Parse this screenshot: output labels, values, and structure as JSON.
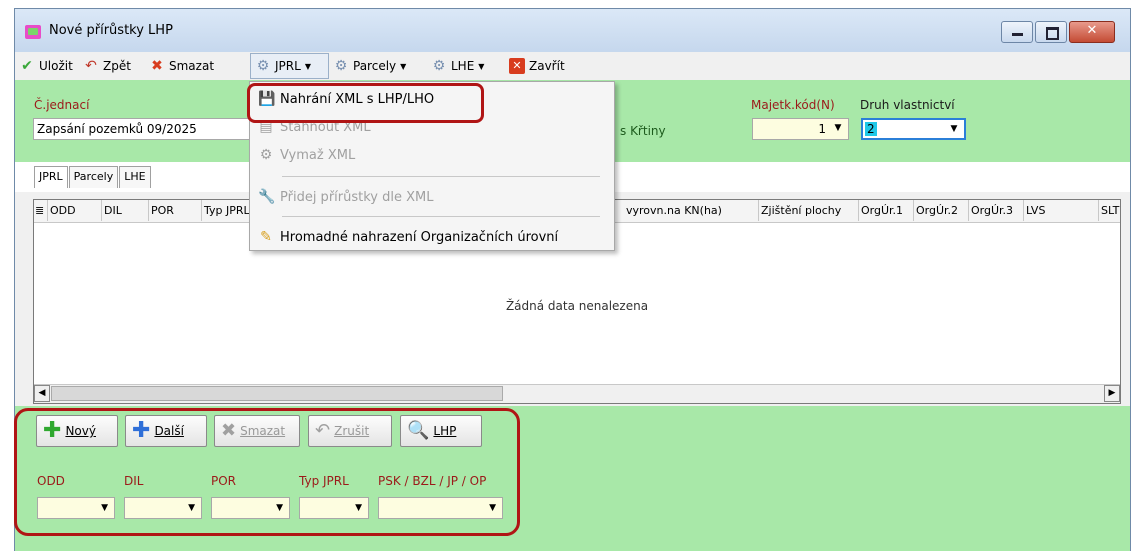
{
  "window": {
    "title": "Nové přírůstky LHP"
  },
  "toolbar": {
    "save": "Uložit",
    "back": "Zpět",
    "delete": "Smazat",
    "jprl": "JPRL",
    "parcely": "Parcely",
    "lhe": "LHE",
    "close": "Zavřít"
  },
  "header": {
    "cj_label": "Č.jednací",
    "cj_value": "Zapsání pozemků 09/2025",
    "partial_text": "s Křtiny",
    "majetk_label": "Majetk.kód(N)",
    "majetk_value": "1",
    "druh_label": "Druh vlastnictví",
    "druh_value": "2"
  },
  "tabs": [
    "JPRL",
    "Parcely",
    "LHE"
  ],
  "grid": {
    "columns": [
      "ODD",
      "DIL",
      "POR",
      "Typ JPRL",
      "vyrovn.na KN(ha)",
      "Zjištění plochy",
      "OrgÚr.1",
      "OrgÚr.2",
      "OrgÚr.3",
      "LVS",
      "SLT"
    ],
    "empty_message": "Žádná data nenalezena"
  },
  "menu": {
    "items": [
      {
        "label": "Nahrání XML s LHP/LHO",
        "enabled": true
      },
      {
        "label": "Stáhnout XML",
        "enabled": false
      },
      {
        "label": "Vymaž XML",
        "enabled": false
      },
      {
        "label": "Přidej přírůstky dle XML",
        "enabled": false
      },
      {
        "label": "Hromadné nahrazení Organizačních úrovní",
        "enabled": true
      }
    ]
  },
  "bottom": {
    "buttons": {
      "new": "Nový",
      "next": "Další",
      "delete": "Smazat",
      "cancel": "Zrušit",
      "lhp": "LHP"
    },
    "labels": {
      "odd": "ODD",
      "dil": "DIL",
      "por": "POR",
      "typ": "Typ JPRL",
      "psk": "PSK / BZL / JP / OP"
    }
  },
  "colors": {
    "panel_green": "#a8e8a8",
    "highlight": "#b01515",
    "label_red": "#9b1a1a"
  }
}
